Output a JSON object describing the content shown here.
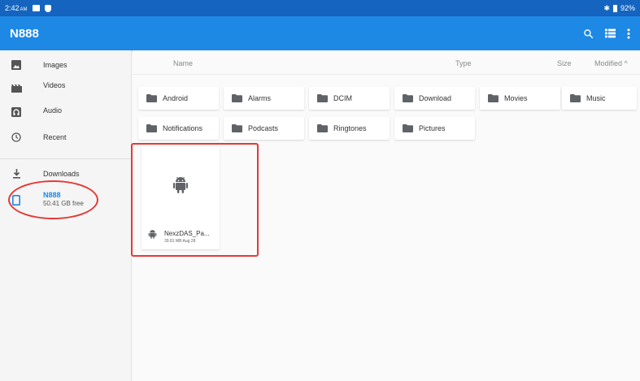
{
  "status_bar": {
    "time": "2:42",
    "ampm": "AM",
    "battery": "92%"
  },
  "app_bar": {
    "title": "N888",
    "search_icon": "search-icon",
    "view_icon": "list-view-icon",
    "more_icon": "more-vert-icon"
  },
  "sidebar": {
    "items": [
      {
        "label": "Images",
        "icon": "image-icon"
      },
      {
        "label": "Videos",
        "icon": "movie-icon"
      },
      {
        "label": "Audio",
        "icon": "audio-icon"
      },
      {
        "label": "Recent",
        "icon": "clock-icon"
      },
      {
        "label": "Downloads",
        "icon": "download-icon"
      },
      {
        "label": "N888",
        "sub": "50.41 GB free",
        "icon": "phone-icon"
      }
    ]
  },
  "columns": {
    "name": "Name",
    "type": "Type",
    "size": "Size",
    "modified": "Modified ^"
  },
  "folders": [
    "Android",
    "Alarms",
    "DCIM",
    "Download",
    "Movies",
    "Music",
    "Notifications",
    "Podcasts",
    "Ringtones",
    "Pictures"
  ],
  "file": {
    "name": "NexzDAS_Pa...",
    "meta": "39.81 MB Aug 28",
    "icon": "android-icon"
  },
  "colors": {
    "status_bar": "#1565c0",
    "app_bar": "#1e88e5",
    "annotation": "#e53935"
  }
}
